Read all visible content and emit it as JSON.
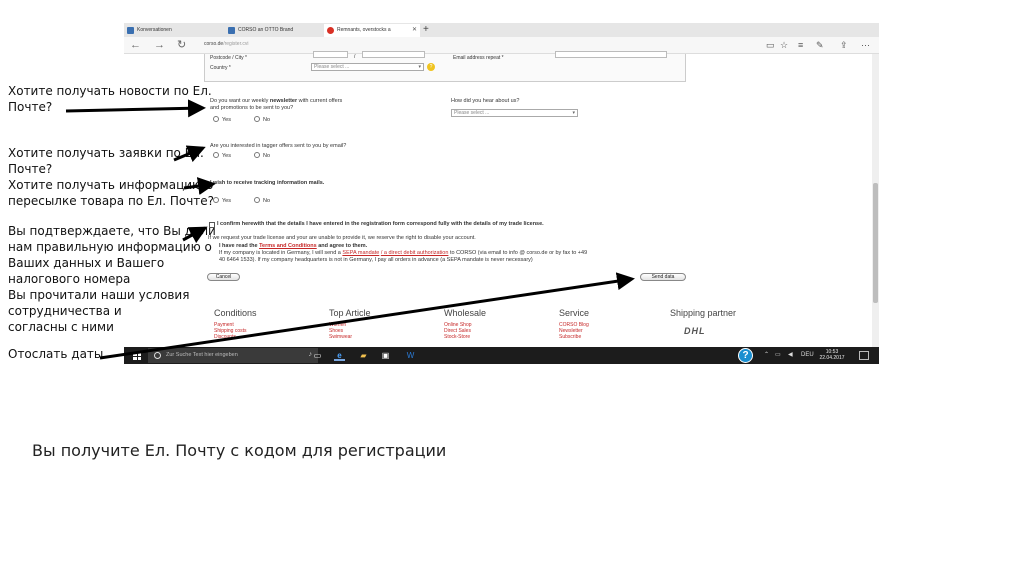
{
  "browser": {
    "tabs": [
      {
        "label": "Konversationen"
      },
      {
        "label": "CORSO an OTTO Brand"
      },
      {
        "label": "Remnants, overstocks a"
      }
    ],
    "address": {
      "host": "corso.de",
      "path": "/register.cvi"
    }
  },
  "form": {
    "postcode_label": "Postcode / City *",
    "email_repeat_label": "Email address repeat *",
    "country_label": "Country *",
    "country_select": "Please select ...",
    "newsletter_q1": "Do you want our weekly",
    "newsletter_q1_bold": "newsletter",
    "newsletter_q1_rest": "with current offers",
    "newsletter_q2": "and promotions to be sent to you?",
    "hear_q": "How did you hear about us?",
    "hear_select": "Please select ...",
    "yes": "Yes",
    "no": "No",
    "tagger_q": "Are you interested in tagger offers sent to you by email?",
    "tracking_q": "I wish to receive tracking information mails.",
    "confirm_text": "I confirm herewith that the details I have entered in the registration form correspond fully with the details of my trade license.",
    "license_note": "If we request your trade license and your are unable to provide it, we reserve the right to disable your account.",
    "terms_pre": "I have read the",
    "terms_link": "Terms and Conditions",
    "terms_post": "and agree to them.",
    "germany_line1_pre": "If my company is located in Germany, I will send a",
    "germany_line1_link": "SEPA mandate",
    "germany_line1_mid": "/ a direct debit authorization",
    "germany_line1_post": "to CORSO (via email to info @ corso.de or by fax to +49",
    "germany_line2": "40 6464 1533). If my company headquarters is not in Germany, I pay all orders in advance (a SEPA mandate is never necessary)",
    "cancel": "Cancel",
    "send": "Send data"
  },
  "footer": {
    "columns": [
      {
        "title": "Conditions",
        "links": [
          "Payment",
          "Shipping costs",
          "Discounts"
        ]
      },
      {
        "title": "Top Article",
        "links": [
          "Women",
          "Shoes",
          "Swimwear"
        ]
      },
      {
        "title": "Wholesale",
        "links": [
          "Online Shop",
          "Direct Sales",
          "Stock-Store"
        ]
      },
      {
        "title": "Service",
        "links": [
          "CORSO Blog",
          "Newsletter",
          "Subscribe"
        ]
      },
      {
        "title": "Shipping partner",
        "links": []
      }
    ],
    "partner_logo": "DHL"
  },
  "taskbar": {
    "search_placeholder": "Zur Suche Text hier eingeben",
    "language": "DEU",
    "time": "10:53",
    "date": "22.04.2017"
  },
  "annotations": {
    "newsletter": [
      "Хотите получать новости по Ел.",
      "Почте?"
    ],
    "tagger": [
      "Хотите получать заявки по Ел.",
      "Почте?"
    ],
    "tracking": [
      "Хотите получать информацию о",
      "пересылке товара по Ел. Почте?"
    ],
    "confirm": [
      "Вы подтверждаете, что Вы дали",
      "нам правильную информацию о",
      "Ваших данных и Вашего",
      "налогового номера",
      "Вы прочитали наши условия",
      "сотрудничества и",
      "согласны с ними"
    ],
    "send": "Отослать даты",
    "bottom": "Вы получите Ел. Почту с кодом для регистрации"
  },
  "colors": {
    "annotation_arrow": "#000000",
    "link_red": "#c62828",
    "taskbar": "#1c1c1c"
  }
}
